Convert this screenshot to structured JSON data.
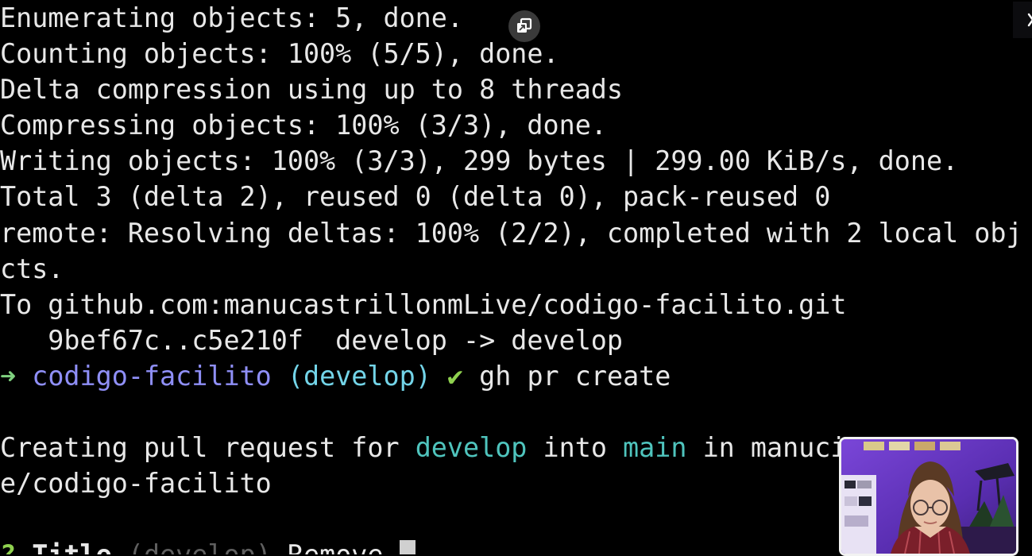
{
  "terminal": {
    "lines": {
      "l1": "Enumerating objects: 5, done.",
      "l2": "Counting objects: 100% (5/5), done.",
      "l3": "Delta compression using up to 8 threads",
      "l4": "Compressing objects: 100% (3/3), done.",
      "l5": "Writing objects: 100% (3/3), 299 bytes | 299.00 KiB/s, done.",
      "l6": "Total 3 (delta 2), reused 0 (delta 0), pack-reused 0",
      "l7": "remote: Resolving deltas: 100% (2/2), completed with 2 local obj",
      "l8": "cts.",
      "l9": "To github.com:manucastrillonmLive/codigo-facilito.git",
      "l10": "   9bef67c..c5e210f  develop -> develop"
    },
    "prompt": {
      "arrow": "➜",
      "directory": "codigo-facilito",
      "branch": "(develop)",
      "check": "✔",
      "command": "gh pr create"
    },
    "creating": {
      "prefix": "Creating pull request for ",
      "head_branch": "develop",
      "middle": " into ",
      "base_branch": "main",
      "suffix": " in manuc",
      "overflow": "ive",
      "wrap": "e/codigo-facilito"
    },
    "title_prompt": {
      "question_mark": "?",
      "label": "Title",
      "default_hint": "(develop)",
      "typed_value": "Remove"
    }
  },
  "colors": {
    "background": "#000000",
    "text": "#e8e8e8",
    "prompt_arrow": "#7fd17f",
    "directory": "#8f8ff7",
    "branch": "#73d4e8",
    "check": "#8fd14f",
    "branch_highlight": "#4fc4bd",
    "webcam_border": "#f2f2f2"
  },
  "icons": {
    "pip": "picture-in-picture-icon",
    "close": "close-icon"
  }
}
